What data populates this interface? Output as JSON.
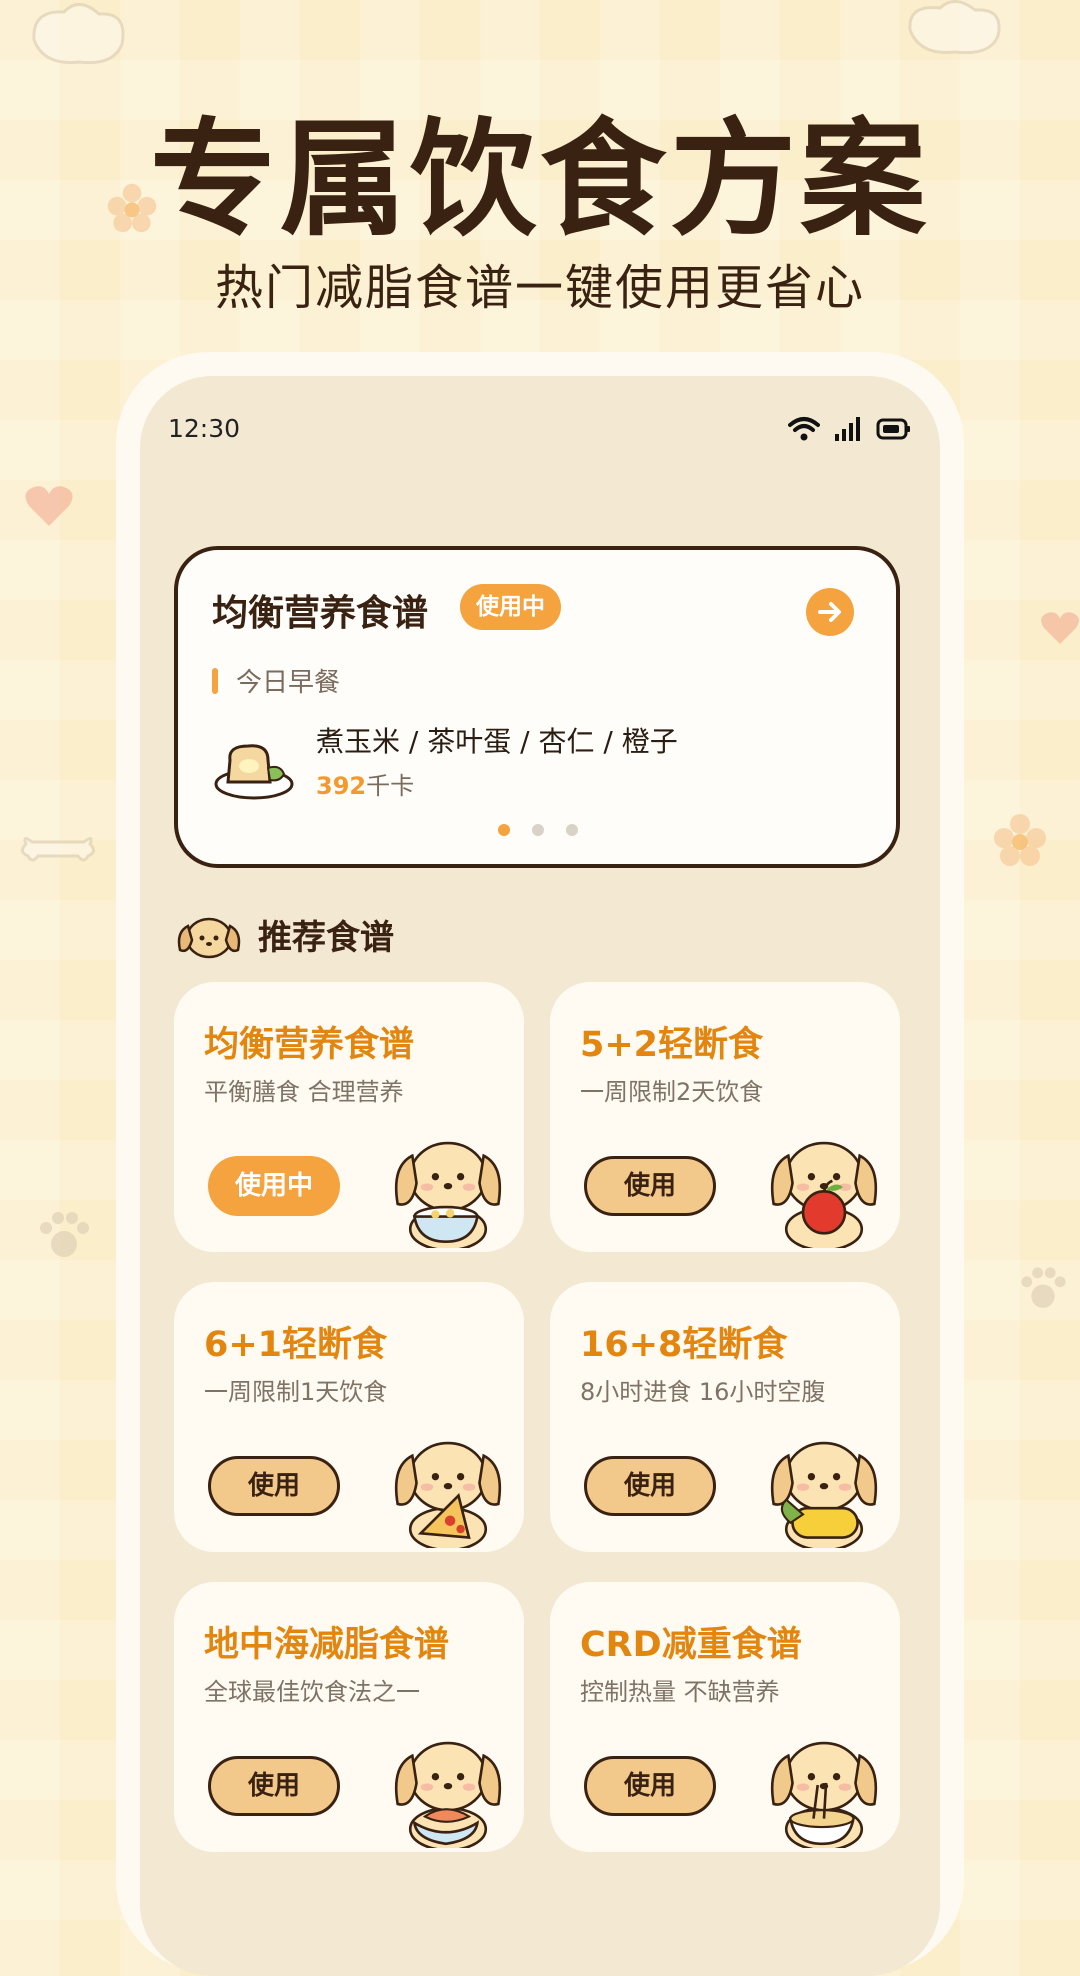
{
  "headline": "专属饮食方案",
  "subheadline": "热门减脂食谱一键使用更省心",
  "status_bar": {
    "time": "12:30"
  },
  "active_plan": {
    "title": "均衡营养食谱",
    "badge": "使用中",
    "meal_label": "今日早餐",
    "foods": "煮玉米 / 茶叶蛋 / 杏仁 / 橙子",
    "kcal_value": "392",
    "kcal_unit": "千卡",
    "dots": [
      true,
      false,
      false
    ]
  },
  "section": {
    "title": "推荐食谱"
  },
  "recipes": [
    {
      "title": "均衡营养食谱",
      "desc": "平衡膳食 合理营养",
      "button": "使用中",
      "active": true,
      "food": "bowl"
    },
    {
      "title": "5+2轻断食",
      "desc": "一周限制2天饮食",
      "button": "使用",
      "active": false,
      "food": "apple"
    },
    {
      "title": "6+1轻断食",
      "desc": "一周限制1天饮食",
      "button": "使用",
      "active": false,
      "food": "pizza"
    },
    {
      "title": "16+8轻断食",
      "desc": "8小时进食 16小时空腹",
      "button": "使用",
      "active": false,
      "food": "corn"
    },
    {
      "title": "地中海减脂食谱",
      "desc": "全球最佳饮食法之一",
      "button": "使用",
      "active": false,
      "food": "salmon"
    },
    {
      "title": "CRD减重食谱",
      "desc": "控制热量 不缺营养",
      "button": "使用",
      "active": false,
      "food": "noodles"
    }
  ],
  "colors": {
    "accent": "#f4a33f",
    "title_orange": "#e3860f",
    "dark_brown": "#3a2212",
    "button_fill": "#f2c98a"
  }
}
